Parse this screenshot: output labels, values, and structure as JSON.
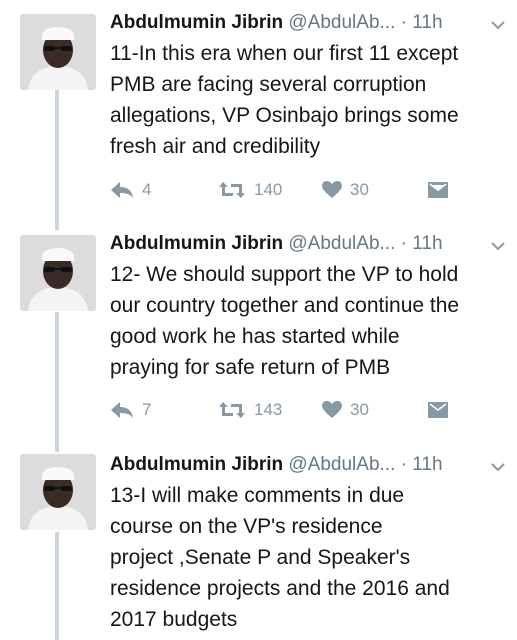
{
  "tweets": [
    {
      "name": "Abdulmumin Jibrin",
      "handle": "@AbdulAb...",
      "separator": "·",
      "time": "11h",
      "text": "11-In this era when our first 11 except\nPMB are facing several corruption\nallegations, VP Osinbajo brings some\nfresh air and credibility",
      "replies": "4",
      "retweets": "140",
      "likes": "30"
    },
    {
      "name": "Abdulmumin Jibrin",
      "handle": "@AbdulAb...",
      "separator": "·",
      "time": "11h",
      "text": "12- We should support the VP to hold\nour  country together and continue the\ngood work he has started  while\npraying for safe return of PMB",
      "replies": "7",
      "retweets": "143",
      "likes": "30"
    },
    {
      "name": "Abdulmumin Jibrin",
      "handle": "@AbdulAb...",
      "separator": "·",
      "time": "11h",
      "text": "13-I will make comments in due\ncourse on the VP's residence\nproject ,Senate P and Speaker's\nresidence projects and the 2016 and\n2017 budgets"
    }
  ],
  "colors": {
    "name": "#14171a",
    "meta": "#657786",
    "action": "#8899a6",
    "thread_line": "#ccd6dd"
  },
  "icons": {
    "reply": "reply-icon",
    "retweet": "retweet-icon",
    "like": "heart-icon",
    "message": "direct-message-icon",
    "menu": "chevron-down-icon",
    "avatar": "avatar"
  }
}
